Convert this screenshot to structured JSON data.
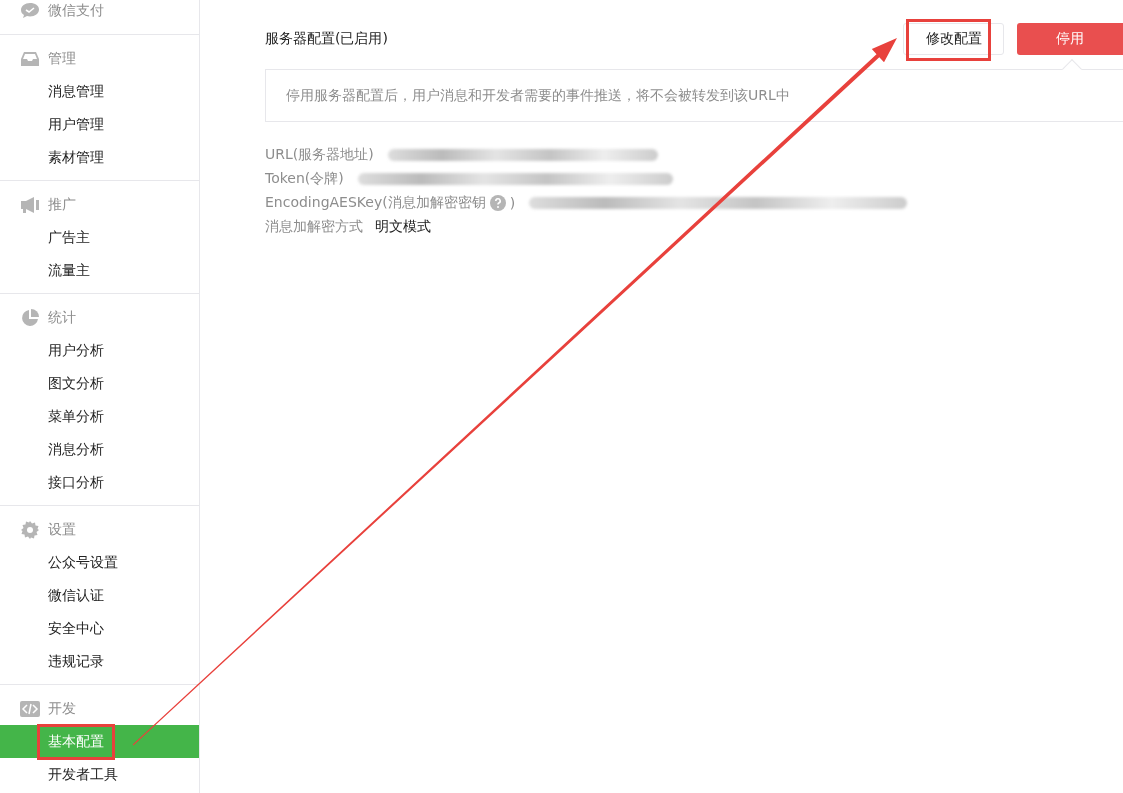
{
  "sidebar": {
    "groups": [
      {
        "label": "微信支付"
      },
      {
        "label": "管理",
        "items": [
          {
            "label": "消息管理",
            "selected": false,
            "annotated": false
          },
          {
            "label": "用户管理",
            "selected": false,
            "annotated": false
          },
          {
            "label": "素材管理",
            "selected": false,
            "annotated": false
          }
        ]
      },
      {
        "label": "推广",
        "items": [
          {
            "label": "广告主",
            "selected": false,
            "annotated": false
          },
          {
            "label": "流量主",
            "selected": false,
            "annotated": false
          }
        ]
      },
      {
        "label": "统计",
        "items": [
          {
            "label": "用户分析",
            "selected": false,
            "annotated": false
          },
          {
            "label": "图文分析",
            "selected": false,
            "annotated": false
          },
          {
            "label": "菜单分析",
            "selected": false,
            "annotated": false
          },
          {
            "label": "消息分析",
            "selected": false,
            "annotated": false
          },
          {
            "label": "接口分析",
            "selected": false,
            "annotated": false
          }
        ]
      },
      {
        "label": "设置",
        "items": [
          {
            "label": "公众号设置",
            "selected": false,
            "annotated": false
          },
          {
            "label": "微信认证",
            "selected": false,
            "annotated": false
          },
          {
            "label": "安全中心",
            "selected": false,
            "annotated": false
          },
          {
            "label": "违规记录",
            "selected": false,
            "annotated": false
          }
        ]
      },
      {
        "label": "开发",
        "items": [
          {
            "label": "基本配置",
            "selected": true,
            "annotated": true
          },
          {
            "label": "开发者工具",
            "selected": false,
            "annotated": false
          }
        ]
      }
    ]
  },
  "main": {
    "title": "服务器配置(已启用)",
    "buttons": [
      {
        "label": "修改配置",
        "kind": "default",
        "annotated": true
      },
      {
        "label": "停用",
        "kind": "danger",
        "annotated": false
      }
    ],
    "notice": "停用服务器配置后，用户消息和开发者需要的事件推送，将不会被转发到该URL中",
    "fields": [
      {
        "label": "URL(服务器地址)",
        "kind": "redacted",
        "help": false
      },
      {
        "label": "Token(令牌)",
        "kind": "redacted",
        "help": false
      },
      {
        "label": "EncodingAESKey(消息加解密密钥",
        "kind": "redacted",
        "help": true,
        "suffix": ")"
      },
      {
        "label": "消息加解密方式",
        "kind": "text",
        "help": false,
        "value": "明文模式"
      }
    ]
  },
  "annotation": {
    "arrow": true
  }
}
